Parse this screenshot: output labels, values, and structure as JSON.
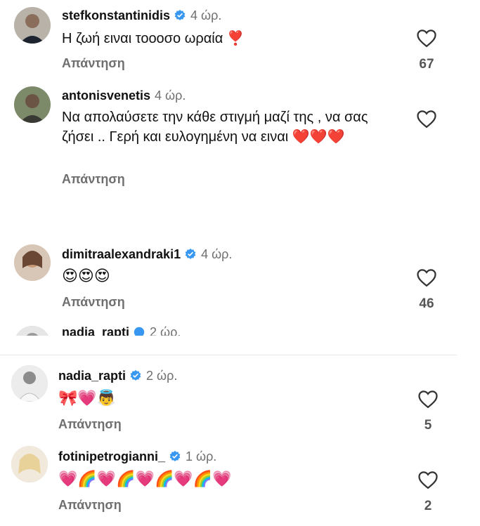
{
  "comments": [
    {
      "user": "stefkonstantinidis",
      "verified": true,
      "time": "4 ώρ.",
      "text": "Η ζωή ειναι τοοοσο ωραία ❣️",
      "reply": "Απάντηση",
      "likes": "67"
    },
    {
      "user": "antonisvenetis",
      "verified": false,
      "time": "4 ώρ.",
      "text": "Να απολαύσετε την κάθε στιγμή μαζί της , να σας ζήσει .. Γερή και ευλογημένη να ειναι ❤️❤️❤️",
      "reply": "Απάντηση",
      "likes": ""
    },
    {
      "user": "dimitraalexandraki1",
      "verified": true,
      "time": "4 ώρ.",
      "text": "😍😍😍",
      "reply": "Απάντηση",
      "likes": "46"
    },
    {
      "user": "nadia_rapti",
      "verified": true,
      "time": "2 ώρ.",
      "text": "🎀💗👼",
      "reply": "Απάντηση",
      "likes": "5"
    },
    {
      "user": "fotinipetrogianni_",
      "verified": true,
      "time": "1 ώρ.",
      "text": "💗🌈💗🌈💗🌈💗🌈💗",
      "reply": "Απάντηση",
      "likes": "2"
    }
  ],
  "clipped_row": {
    "user": "nadia_rapti",
    "time": "2 ώρ."
  },
  "colors": {
    "verified": "#3897f0",
    "muted": "#6f6f6f"
  },
  "icons": [
    "heart-outline-icon",
    "verified-badge-icon"
  ]
}
